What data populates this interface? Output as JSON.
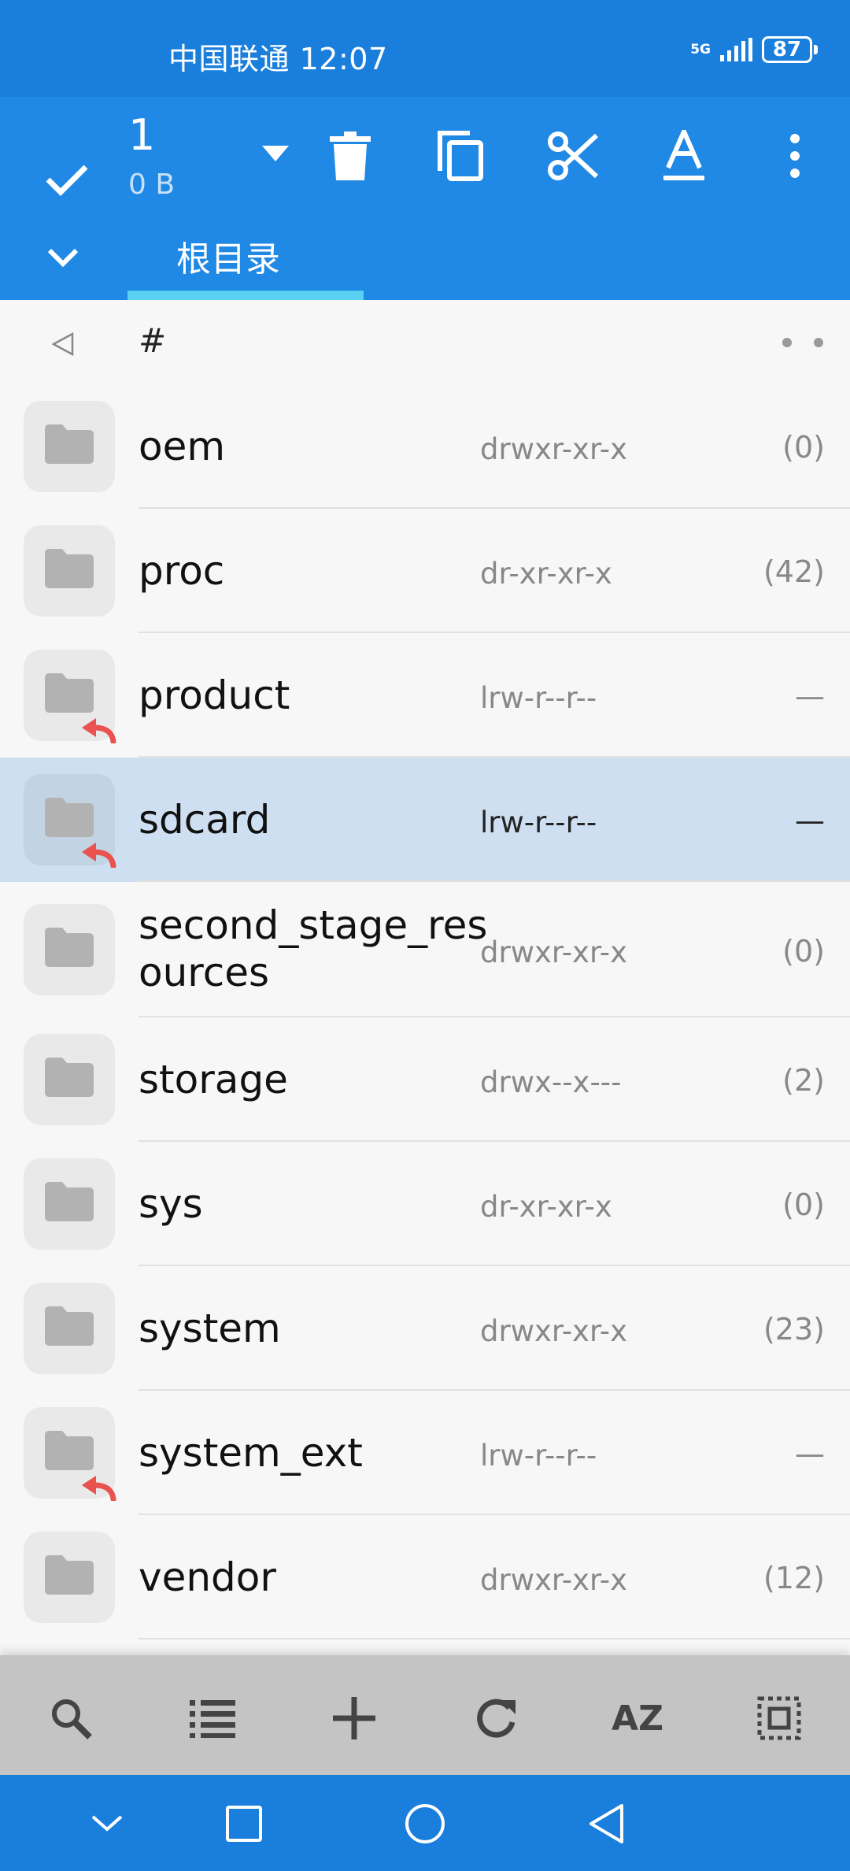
{
  "status_bar": {
    "carrier": "中国联通",
    "time": "12:07",
    "network": "5G",
    "battery": "87"
  },
  "toolbar": {
    "selected_count": "1",
    "selected_size": "0 B",
    "icons": [
      "check-icon",
      "dropdown-icon",
      "trash-icon",
      "copy-icon",
      "cut-icon",
      "rename-icon",
      "more-icon"
    ]
  },
  "tabs": [
    {
      "label": "根目录",
      "active": true
    }
  ],
  "path_bar": {
    "path": "#"
  },
  "files": [
    {
      "name": "oem",
      "permissions": "drwxr-xr-x",
      "count": "(0)",
      "symlink": false,
      "selected": false
    },
    {
      "name": "proc",
      "permissions": "dr-xr-xr-x",
      "count": "(42)",
      "symlink": false,
      "selected": false
    },
    {
      "name": "product",
      "permissions": "lrw-r--r--",
      "count": "—",
      "symlink": true,
      "selected": false
    },
    {
      "name": "sdcard",
      "permissions": "lrw-r--r--",
      "count": "—",
      "symlink": true,
      "selected": true
    },
    {
      "name": "second_stage_resources",
      "name_lines": [
        "second_stage_res",
        "ources"
      ],
      "permissions": "drwxr-xr-x",
      "count": "(0)",
      "symlink": false,
      "selected": false
    },
    {
      "name": "storage",
      "permissions": "drwx--x---",
      "count": "(2)",
      "symlink": false,
      "selected": false
    },
    {
      "name": "sys",
      "permissions": "dr-xr-xr-x",
      "count": "(0)",
      "symlink": false,
      "selected": false
    },
    {
      "name": "system",
      "permissions": "drwxr-xr-x",
      "count": "(23)",
      "symlink": false,
      "selected": false
    },
    {
      "name": "system_ext",
      "permissions": "lrw-r--r--",
      "count": "—",
      "symlink": true,
      "selected": false
    },
    {
      "name": "vendor",
      "permissions": "drwxr-xr-x",
      "count": "(12)",
      "symlink": false,
      "selected": false
    }
  ],
  "bottom_bar": {
    "sort_label": "AZ",
    "icons": [
      "search-icon",
      "list-view-icon",
      "add-icon",
      "refresh-icon",
      "sort-icon",
      "select-all-icon"
    ]
  },
  "colors": {
    "status_bar": "#1a7fdc",
    "toolbar": "#2088e5",
    "tab_indicator": "#5ad0f2",
    "selected_row": "#cddff0",
    "symlink_arrow": "#e9524f",
    "folder_icon": "#b2b2b2"
  }
}
